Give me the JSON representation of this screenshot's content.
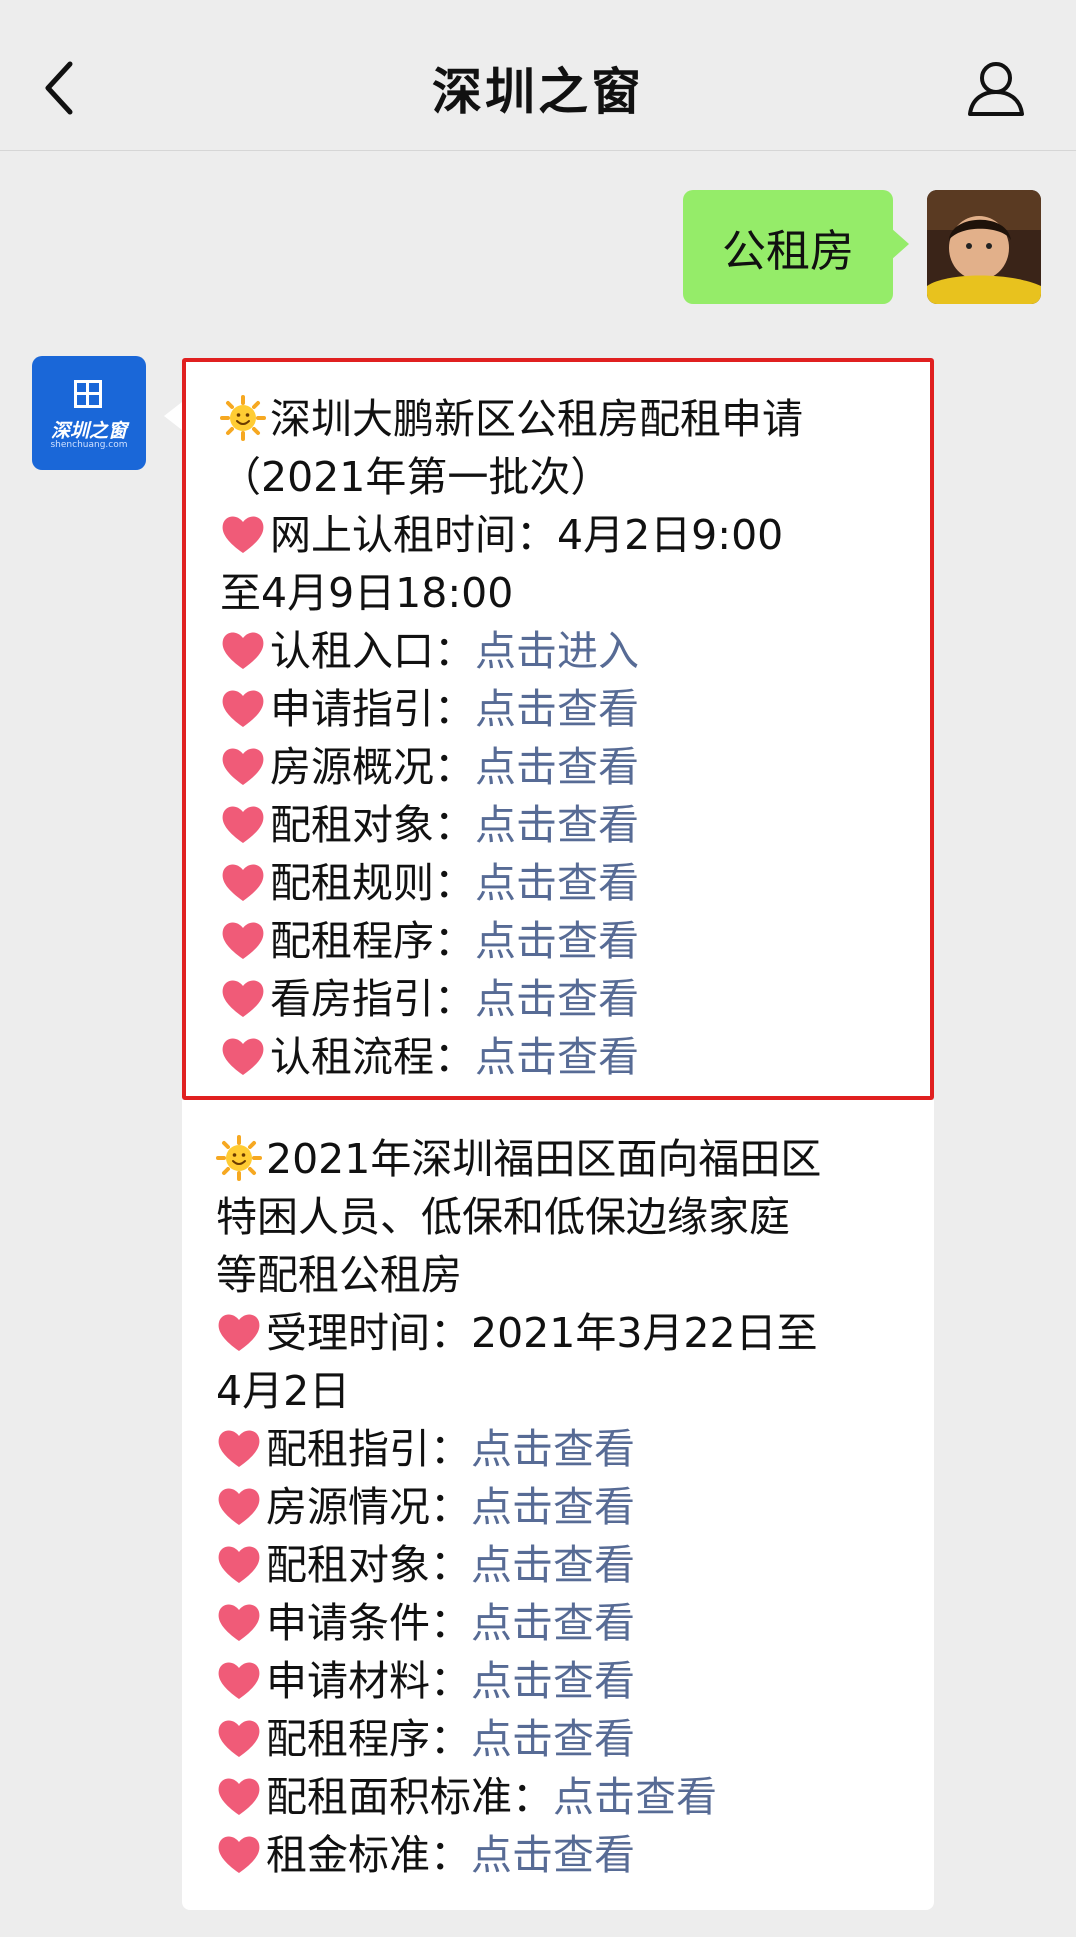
{
  "nav": {
    "title": "深圳之窗"
  },
  "user_message": {
    "text": "公租房"
  },
  "bot": {
    "logo_text": "深圳之窗",
    "logo_sub": "shenchuang.com"
  },
  "card1": {
    "title_line1": "深圳大鹏新区公租房配租申请",
    "title_line2": "（2021年第一批次）",
    "time_line1": "网上认租时间：4月2日9:00",
    "time_line2": "至4月9日18:00",
    "items": [
      {
        "label": "认租入口：",
        "link": "点击进入"
      },
      {
        "label": "申请指引：",
        "link": "点击查看"
      },
      {
        "label": "房源概况：",
        "link": "点击查看"
      },
      {
        "label": "配租对象：",
        "link": "点击查看"
      },
      {
        "label": "配租规则：",
        "link": "点击查看"
      },
      {
        "label": "配租程序：",
        "link": "点击查看"
      },
      {
        "label": "看房指引：",
        "link": "点击查看"
      },
      {
        "label": "认租流程：",
        "link": "点击查看"
      }
    ]
  },
  "card2": {
    "title_line1": "2021年深圳福田区面向福田区",
    "title_line2": "特困人员、低保和低保边缘家庭",
    "title_line3": "等配租公租房",
    "time_line1": "受理时间：2021年3月22日至",
    "time_line2": "4月2日",
    "items": [
      {
        "label": "配租指引：",
        "link": "点击查看"
      },
      {
        "label": "房源情况：",
        "link": "点击查看"
      },
      {
        "label": "配租对象：",
        "link": "点击查看"
      },
      {
        "label": "申请条件：",
        "link": "点击查看"
      },
      {
        "label": "申请材料：",
        "link": "点击查看"
      },
      {
        "label": "配租程序：",
        "link": "点击查看"
      },
      {
        "label": "配租面积标准：",
        "link": "点击查看"
      },
      {
        "label": "租金标准：",
        "link": "点击查看"
      }
    ]
  },
  "colors": {
    "link": "#576b95",
    "user_bubble": "#95ec69",
    "highlight_border": "#e02020"
  }
}
